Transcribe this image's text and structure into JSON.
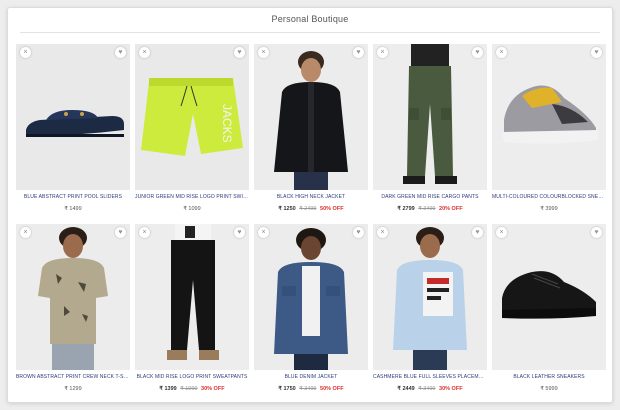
{
  "section": {
    "title": "Personal Boutique"
  },
  "icons": {
    "remove": "×",
    "wishlist": "♥"
  },
  "products": [
    {
      "name": "BLUE ABSTRACT PRINT POOL SLIDERS",
      "price": "₹ 1499",
      "mrp": "",
      "discount": ""
    },
    {
      "name": "JUNIOR GREEN MID RISE LOGO PRINT SWIMSHORTS",
      "price": "₹ 1099",
      "mrp": "",
      "discount": ""
    },
    {
      "name": "BLACK HIGH NECK JACKET",
      "price": "₹ 1250",
      "mrp": "₹ 2499",
      "discount": "50% OFF"
    },
    {
      "name": "DARK GREEN MID RISE CARGO PANTS",
      "price": "₹ 2799",
      "mrp": "₹ 3499",
      "discount": "20% OFF"
    },
    {
      "name": "MULTI-COLOURED COLOURBLOCKED SNEAKERS",
      "price": "₹ 3999",
      "mrp": "",
      "discount": ""
    },
    {
      "name": "BROWN ABSTRACT PRINT CREW NECK T-SHIRT",
      "price": "₹ 1299",
      "mrp": "",
      "discount": ""
    },
    {
      "name": "BLACK MID RISE LOGO PRINT SWEATPANTS",
      "price": "₹ 1399",
      "mrp": "₹ 1999",
      "discount": "30% OFF"
    },
    {
      "name": "BLUE DENIM JACKET",
      "price": "₹ 1750",
      "mrp": "₹ 3499",
      "discount": "50% OFF"
    },
    {
      "name": "CASHMERE BLUE FULL SLEEVES PLACEMENT PRINT SHIRT",
      "price": "₹ 2449",
      "mrp": "₹ 3499",
      "discount": "30% OFF"
    },
    {
      "name": "BLACK LEATHER SNEAKERS",
      "price": "₹ 5999",
      "mrp": "",
      "discount": ""
    }
  ]
}
